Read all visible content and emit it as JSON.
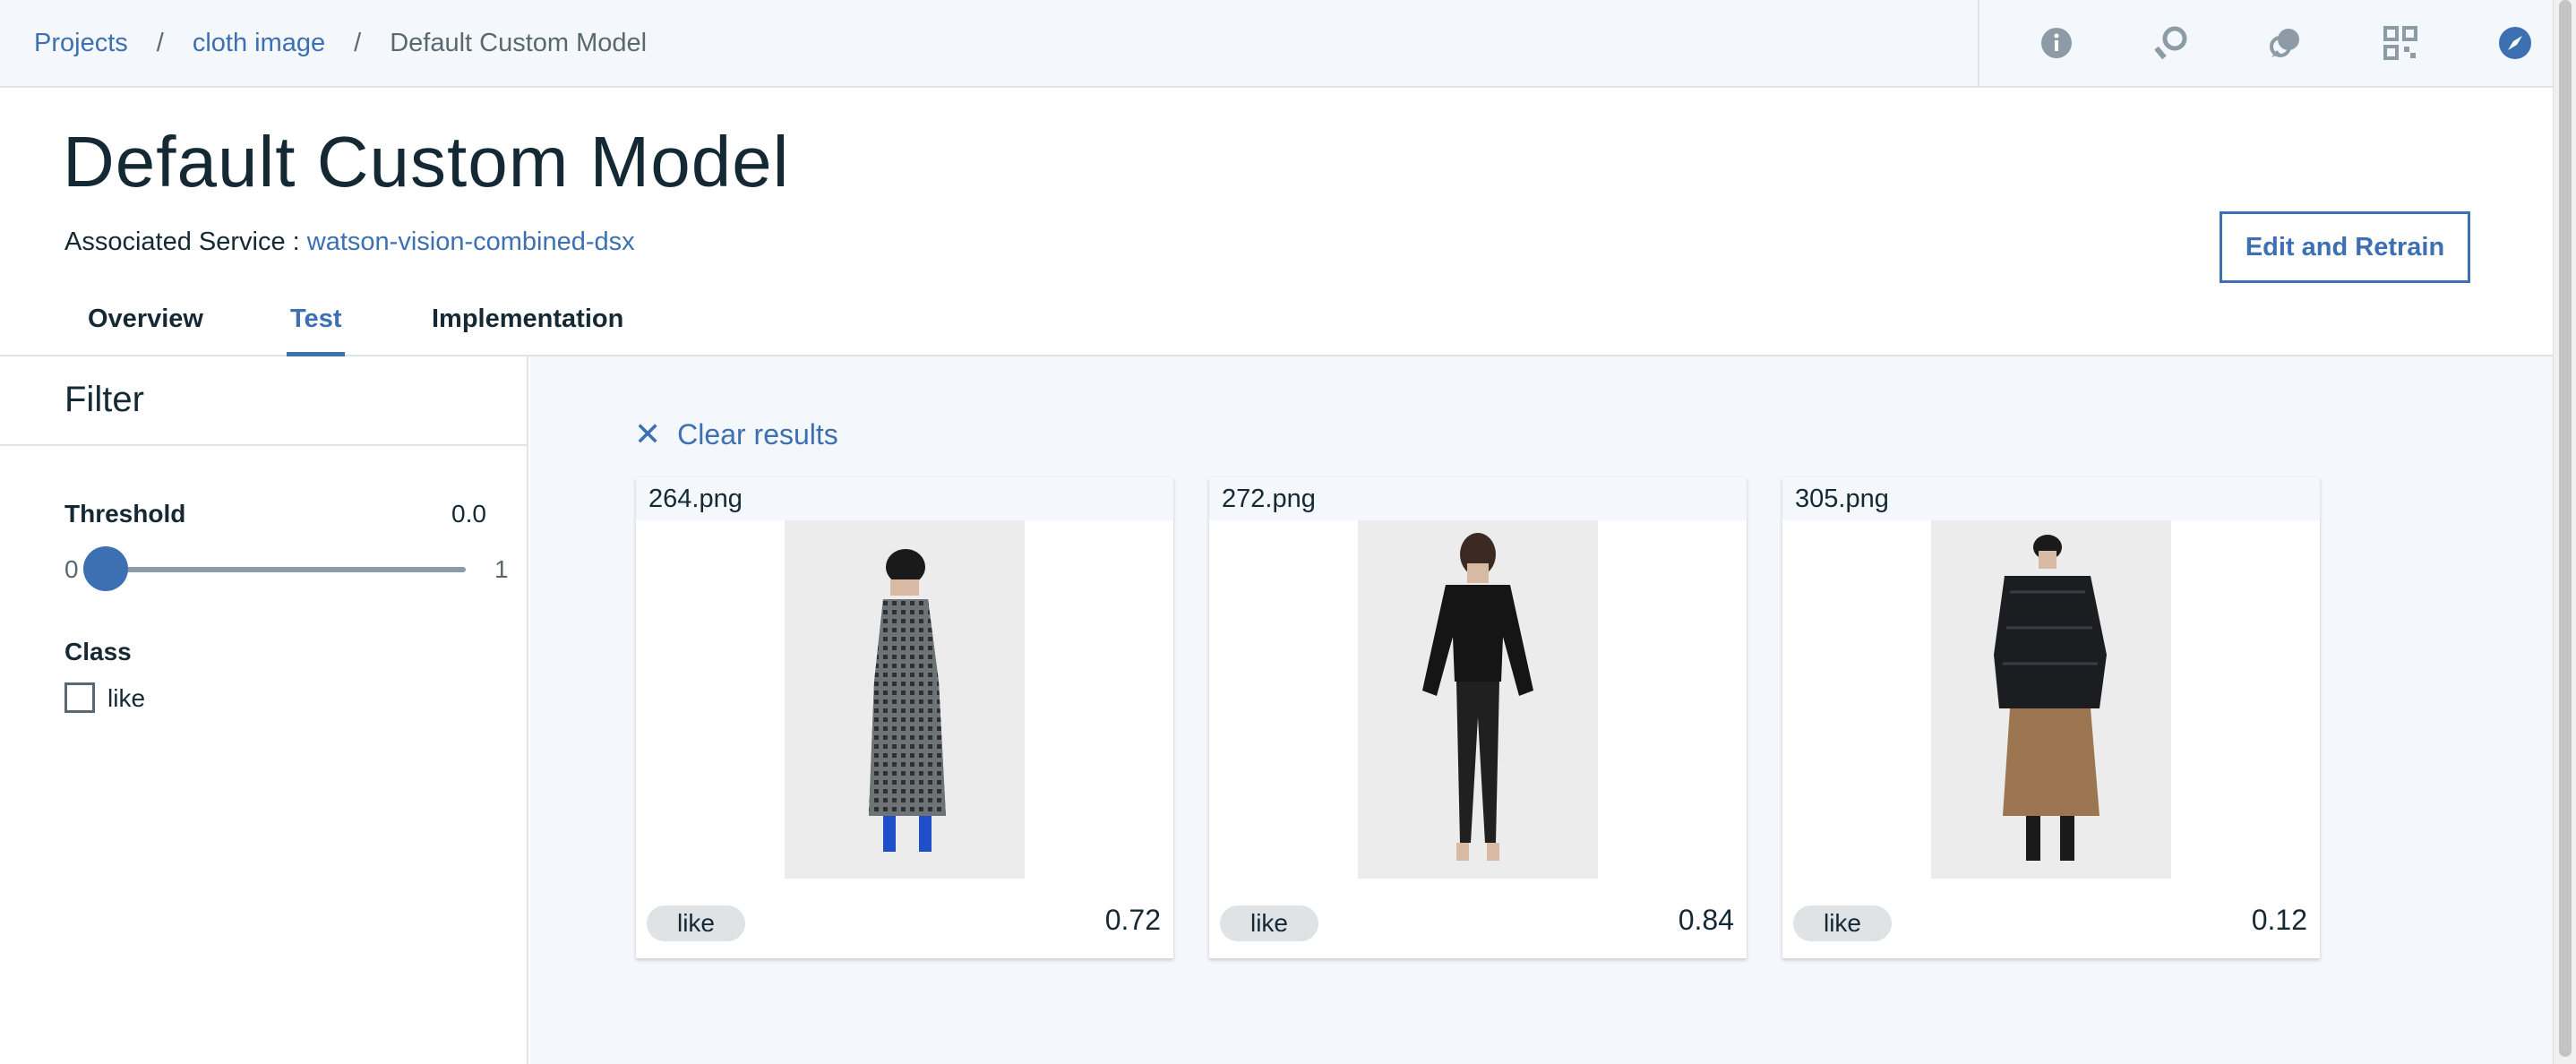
{
  "breadcrumb": {
    "items": [
      "Projects",
      "cloth image"
    ],
    "separator": "/",
    "current": "Default Custom Model"
  },
  "topbar_icons": [
    "info-icon",
    "feedback-icon",
    "chat-icon",
    "qr-code-icon",
    "compass-icon"
  ],
  "header": {
    "title": "Default Custom Model",
    "assoc_label": "Associated Service : ",
    "assoc_link": "watson-vision-combined-dsx",
    "edit_button": "Edit and Retrain"
  },
  "tabs": [
    {
      "label": "Overview",
      "active": false
    },
    {
      "label": "Test",
      "active": true
    },
    {
      "label": "Implementation",
      "active": false
    }
  ],
  "filter": {
    "title": "Filter",
    "threshold_label": "Threshold",
    "threshold_value": "0.0",
    "slider_min": "0",
    "slider_max": "1",
    "slider_level": 0.0,
    "class_label": "Class",
    "class_options": [
      {
        "label": "like",
        "checked": false
      }
    ]
  },
  "results": {
    "clear_label": "Clear results",
    "cards": [
      {
        "filename": "264.png",
        "tag": "like",
        "score": "0.72"
      },
      {
        "filename": "272.png",
        "tag": "like",
        "score": "0.84"
      },
      {
        "filename": "305.png",
        "tag": "like",
        "score": "0.12"
      }
    ]
  },
  "colors": {
    "accent": "#3d70b2",
    "text": "#152935",
    "muted": "#5a6872",
    "background": "#f4f7fb"
  }
}
